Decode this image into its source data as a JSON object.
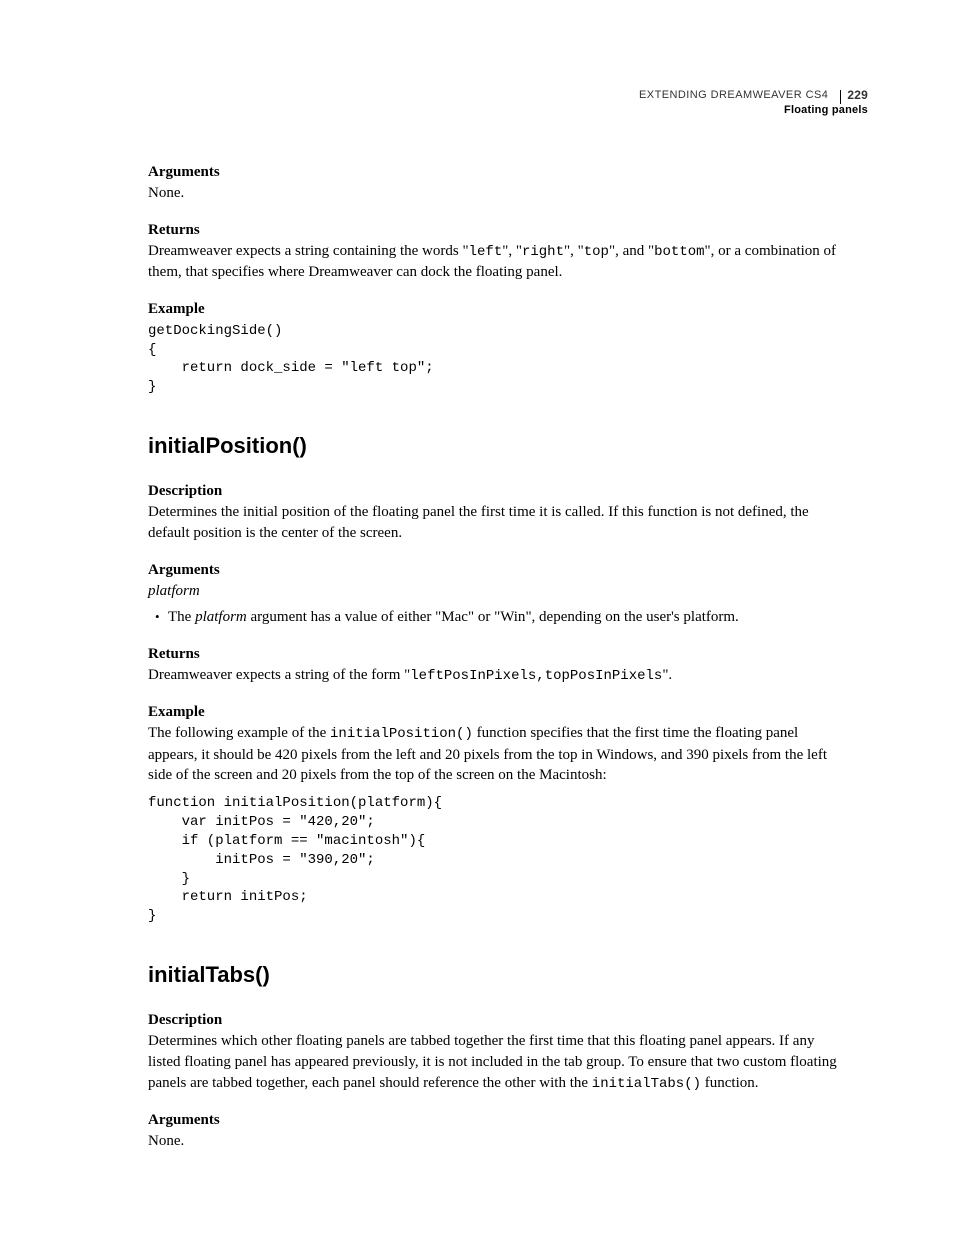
{
  "header": {
    "book_title": "EXTENDING DREAMWEAVER CS4",
    "page_number": "229",
    "chapter": "Floating panels"
  },
  "sections": {
    "args1": {
      "heading": "Arguments",
      "body": "None."
    },
    "returns1": {
      "heading": "Returns",
      "body_pre": "Dreamweaver expects a string containing the words \"",
      "c1": "left",
      "s1": "\", \"",
      "c2": "right",
      "s2": "\", \"",
      "c3": "top",
      "s3": "\", and \"",
      "c4": "bottom",
      "body_post": "\", or a combination of them, that specifies where Dreamweaver can dock the floating panel."
    },
    "example1": {
      "heading": "Example",
      "code": "getDockingSide()\n{\n    return dock_side = \"left top\";\n}"
    },
    "func1": {
      "title": "initialPosition()"
    },
    "desc1": {
      "heading": "Description",
      "body": "Determines the initial position of the floating panel the first time it is called. If this function is not defined, the default position is the center of the screen."
    },
    "args2": {
      "heading": "Arguments",
      "platform": "platform",
      "bullet_pre": "The ",
      "bullet_em": "platform",
      "bullet_mid": " argument has a value of either \"",
      "bullet_c1": "Mac",
      "bullet_mid2": "\" or \"",
      "bullet_c2": "Win",
      "bullet_post": "\", depending on the user's platform."
    },
    "returns2": {
      "heading": "Returns",
      "body_pre": "Dreamweaver expects a string of the form \"",
      "code": "leftPosInPixels,topPosInPixels",
      "body_post": "\"."
    },
    "example2": {
      "heading": "Example",
      "intro_pre": "The following example of the ",
      "intro_code": "initialPosition()",
      "intro_post": " function specifies that the first time the floating panel appears, it should be 420 pixels from the left and 20 pixels from the top in Windows, and 390 pixels from the left side of the screen and 20 pixels from the top of the screen on the Macintosh:",
      "code": "function initialPosition(platform){\n    var initPos = \"420,20\";\n    if (platform == \"macintosh\"){\n        initPos = \"390,20\";\n    }\n    return initPos;\n}"
    },
    "func2": {
      "title": "initialTabs()"
    },
    "desc2": {
      "heading": "Description",
      "body_pre": "Determines which other floating panels are tabbed together the first time that this floating panel appears. If any listed floating panel has appeared previously, it is not included in the tab group. To ensure that two custom floating panels are tabbed together, each panel should reference the other with the ",
      "code": "initialTabs()",
      "body_post": " function."
    },
    "args3": {
      "heading": "Arguments",
      "body": "None."
    }
  }
}
